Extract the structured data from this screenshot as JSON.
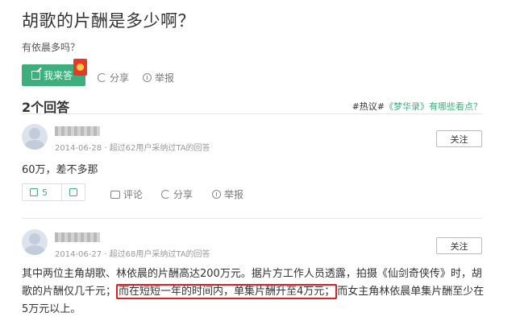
{
  "question": {
    "title": "胡歌的片酬是多少啊？",
    "subtitle": "有依晨多吗？"
  },
  "actions": {
    "answer_label": "我来答",
    "share_label": "分享",
    "report_label": "举报"
  },
  "answers_header": {
    "count_label": "2个回答",
    "hot_tag": "#热议#",
    "hot_link": "《梦华录》有哪些看点？"
  },
  "answers": [
    {
      "meta": "2014-06-28 · 超过62用户采纳过TA的回答",
      "follow_label": "关注",
      "text": "60万，差不多那",
      "likes": "5",
      "comment_label": "评论",
      "share_label": "分享",
      "report_label": "举报"
    },
    {
      "meta": "2014-06-27 · 超过68用户采纳过TA的回答",
      "follow_label": "关注",
      "text_part1": "其中两位主角胡歌、林依晨的片酬高达200万元。据片方工作人员透露，拍摄《仙剑奇侠传》时，胡歌的片酬仅几千元；",
      "text_highlight": "而在短短一年的时间内，单集片酬升至4万元；",
      "text_part2": "而女主角林依晨单集片酬至少在5万元以上。"
    }
  ],
  "colors": {
    "accent": "#3eaf7c",
    "highlight_border": "#e02020"
  }
}
